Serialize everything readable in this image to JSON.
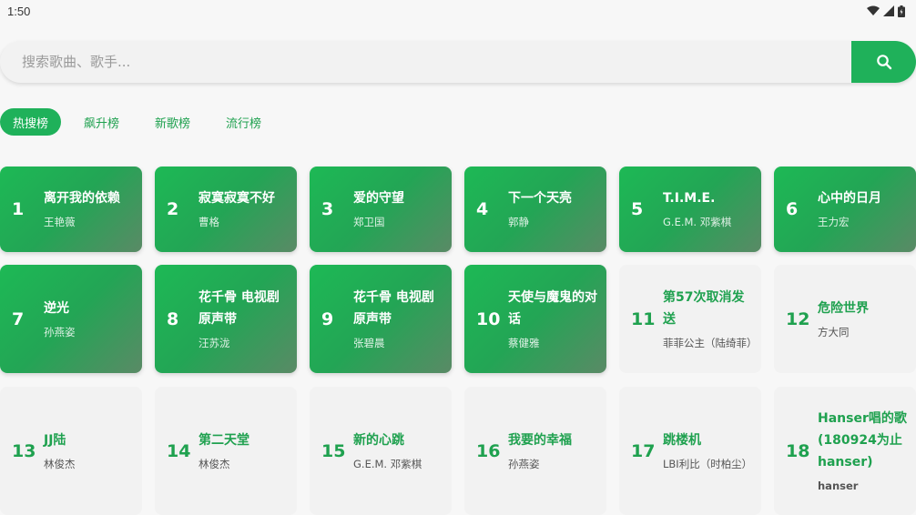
{
  "status": {
    "time": "1:50"
  },
  "search": {
    "placeholder": "搜索歌曲、歌手..."
  },
  "tabs": [
    {
      "label": "热搜榜"
    },
    {
      "label": "飙升榜"
    },
    {
      "label": "新歌榜"
    },
    {
      "label": "流行榜"
    }
  ],
  "songs": [
    {
      "rank": "1",
      "title": "离开我的依赖",
      "artist": "王艳薇"
    },
    {
      "rank": "2",
      "title": "寂寞寂寞不好",
      "artist": "曹格"
    },
    {
      "rank": "3",
      "title": "爱的守望",
      "artist": "郑卫国"
    },
    {
      "rank": "4",
      "title": "下一个天亮",
      "artist": "郭静"
    },
    {
      "rank": "5",
      "title": "T.I.M.E.",
      "artist": "G.E.M. 邓紫棋"
    },
    {
      "rank": "6",
      "title": "心中的日月",
      "artist": "王力宏"
    },
    {
      "rank": "7",
      "title": "逆光",
      "artist": "孙燕姿"
    },
    {
      "rank": "8",
      "title": "花千骨 电视剧原声带",
      "artist": "汪苏泷"
    },
    {
      "rank": "9",
      "title": "花千骨 电视剧原声带",
      "artist": "张碧晨"
    },
    {
      "rank": "10",
      "title": "天使与魔鬼的对话",
      "artist": "蔡健雅"
    },
    {
      "rank": "11",
      "title": "第57次取消发送",
      "artist": "菲菲公主（陆绮菲）"
    },
    {
      "rank": "12",
      "title": "危险世界",
      "artist": "方大同"
    },
    {
      "rank": "13",
      "title": "JJ陆",
      "artist": "林俊杰"
    },
    {
      "rank": "14",
      "title": "第二天堂",
      "artist": "林俊杰"
    },
    {
      "rank": "15",
      "title": "新的心跳",
      "artist": "G.E.M. 邓紫棋"
    },
    {
      "rank": "16",
      "title": "我要的幸福",
      "artist": "孙燕姿"
    },
    {
      "rank": "17",
      "title": "跳楼机",
      "artist": "LBI利比（时柏尘）"
    },
    {
      "rank": "18",
      "title": "Hanser唱的歌 (180924为止 hanser)",
      "artist": "hanser"
    }
  ]
}
